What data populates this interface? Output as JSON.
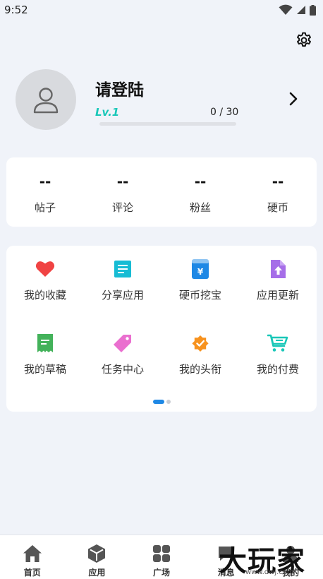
{
  "status_bar": {
    "time": "9:52",
    "icons": [
      "wifi-icon",
      "signal-icon",
      "battery-icon"
    ]
  },
  "header": {
    "settings_icon": "gear-icon"
  },
  "profile": {
    "username": "请登陆",
    "level": "Lv.1",
    "xp_text": "0 / 30",
    "xp_progress": 0,
    "accent_color": "#19c7b8"
  },
  "stats": [
    {
      "value": "--",
      "label": "帖子"
    },
    {
      "value": "--",
      "label": "评论"
    },
    {
      "value": "--",
      "label": "粉丝"
    },
    {
      "value": "--",
      "label": "硬币"
    }
  ],
  "menu": {
    "items": [
      {
        "label": "我的收藏",
        "icon": "heart-icon",
        "color": "#f04343"
      },
      {
        "label": "分享应用",
        "icon": "document-icon",
        "color": "#17bcd4"
      },
      {
        "label": "硬币挖宝",
        "icon": "coin-pouch-icon",
        "color": "#1e88e5"
      },
      {
        "label": "应用更新",
        "icon": "upload-file-icon",
        "color": "#a66ee8"
      },
      {
        "label": "我的草稿",
        "icon": "draft-icon",
        "color": "#43b25a"
      },
      {
        "label": "任务中心",
        "icon": "tag-icon",
        "color": "#ea6fcf"
      },
      {
        "label": "我的头衔",
        "icon": "badge-check-icon",
        "color": "#f7921e"
      },
      {
        "label": "我的付费",
        "icon": "cart-icon",
        "color": "#19c7b8"
      }
    ],
    "page_count": 2,
    "active_page": 1,
    "active_dot_color": "#1e88e5"
  },
  "bottom_nav": [
    {
      "label": "首页",
      "icon": "home-icon"
    },
    {
      "label": "应用",
      "icon": "cube-icon"
    },
    {
      "label": "广场",
      "icon": "grid-icon"
    },
    {
      "label": "消息",
      "icon": "message-icon"
    },
    {
      "label": "我的",
      "icon": "profile-icon"
    }
  ],
  "watermark": {
    "text": "大玩家",
    "url": "www.dwj.com"
  }
}
